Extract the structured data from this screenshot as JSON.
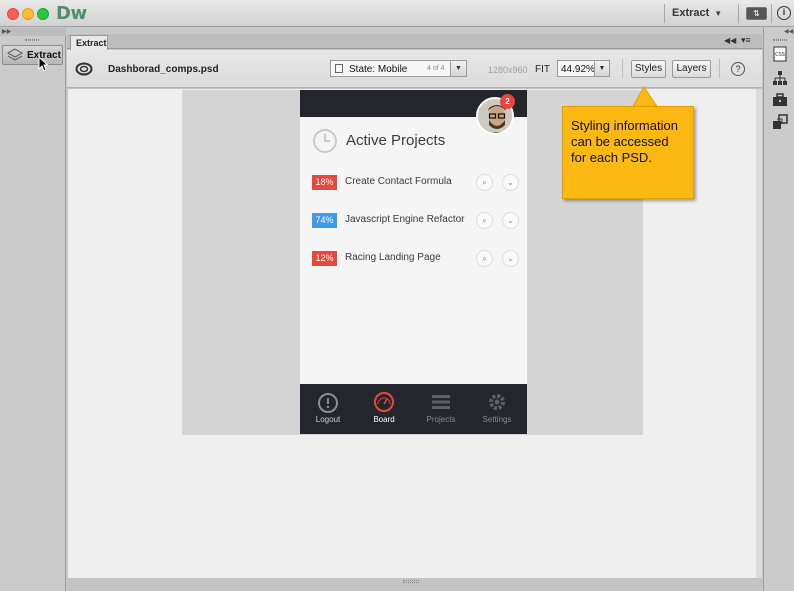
{
  "app": {
    "logo": "Dw",
    "workspace": "Extract"
  },
  "left_rail": {
    "extract_button": "Extract"
  },
  "panel": {
    "tab_label": "Extract",
    "filename": "Dashborad_comps.psd",
    "state": {
      "label": "State: Mobile",
      "count": "4 of 4"
    },
    "dimensions": "1280x960",
    "fit_label": "FIT",
    "zoom": "44.92%",
    "styles_button": "Styles",
    "layers_button": "Layers",
    "help": "?"
  },
  "mockup": {
    "notification_count": "2",
    "section_title": "Active Projects",
    "projects": [
      {
        "percent": "18%",
        "name": "Create Contact Formula",
        "color": "#e8473d"
      },
      {
        "percent": "74%",
        "name": "Javascript Engine Refactor",
        "color": "#3d9be9"
      },
      {
        "percent": "12%",
        "name": "Racing Landing Page",
        "color": "#e8473d"
      }
    ],
    "tabs": [
      {
        "label": "Logout",
        "icon": "logout-icon"
      },
      {
        "label": "Board",
        "icon": "dashboard-gauge-icon"
      },
      {
        "label": "Projects",
        "icon": "projects-list-icon"
      },
      {
        "label": "Settings",
        "icon": "gear-icon"
      }
    ],
    "accent_color": "#e8473d",
    "dark_color": "#23262c"
  },
  "callout": {
    "text": "Styling information can be accessed for each PSD."
  }
}
